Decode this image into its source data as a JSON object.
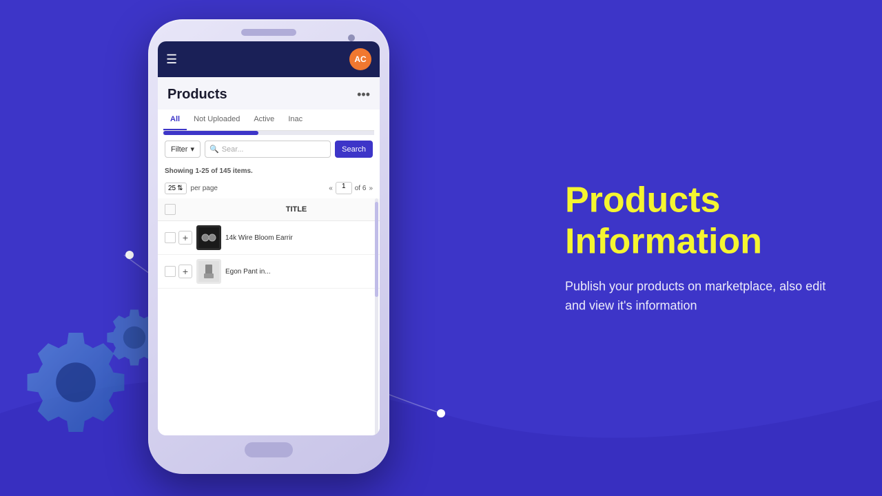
{
  "background": {
    "color": "#3d35c8"
  },
  "header": {
    "avatar_initials": "AC",
    "hamburger_label": "☰"
  },
  "products_section": {
    "title": "Products",
    "more_options": "•••",
    "tabs": [
      {
        "label": "All",
        "active": true
      },
      {
        "label": "Not Uploaded",
        "active": false
      },
      {
        "label": "Active",
        "active": false
      },
      {
        "label": "Inac",
        "active": false
      }
    ],
    "filter_label": "Filter",
    "search_placeholder": "Sear...",
    "search_button": "Search",
    "showing_text": "Showing ",
    "showing_range": "1-25",
    "showing_of": " of ",
    "showing_count": "145",
    "showing_items": " items.",
    "per_page": "25",
    "per_page_label": "per page",
    "current_page": "1",
    "total_pages": "6",
    "table_col_title": "TITLE",
    "products": [
      {
        "name": "14k Wire Bloom Earrir",
        "has_dark_thumb": true
      },
      {
        "name": "Egon Pant in...",
        "has_dark_thumb": false
      }
    ]
  },
  "right_panel": {
    "heading_line1": "Products",
    "heading_line2": "Information",
    "description": "Publish your products on marketplace, also edit and view it's information"
  }
}
